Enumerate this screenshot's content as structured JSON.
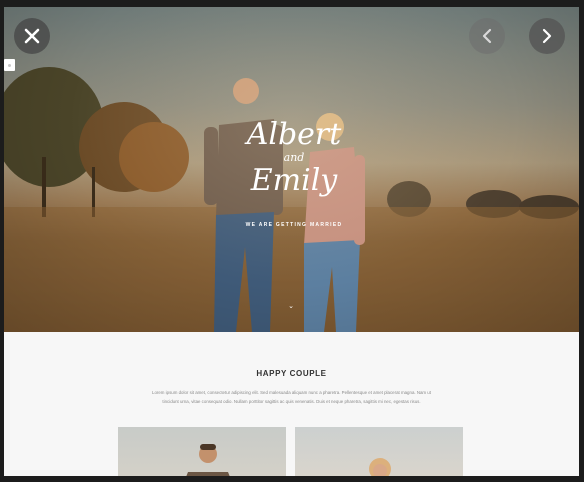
{
  "hero": {
    "name_first": "Albert",
    "ampersand": "and",
    "name_second": "Emily",
    "tagline": "WE ARE GETTING MARRIED",
    "scroll_glyph": "⌄"
  },
  "section": {
    "title": "HAPPY COUPLE",
    "body": "Lorem ipsum dolor sit amet, consectetur adipiscing elit. Sed malesuada aliquam nunc a pharetra. Pellentesque et amet placerat magna. Nam ut tincidunt urna, vitae consequat odio. Nullam porttitor sagittis ac quis venenatis. Duis et neque pharetra, sagittis mi nec, egestas risus."
  },
  "controls": {
    "close_icon": "close-icon",
    "prev_icon": "chevron-left-icon",
    "next_icon": "chevron-right-icon"
  },
  "colors": {
    "overlay_background": "#1c1c1c",
    "page_background": "#f7f7f7",
    "heading_text": "#333333",
    "body_text": "#8a8a8a"
  }
}
